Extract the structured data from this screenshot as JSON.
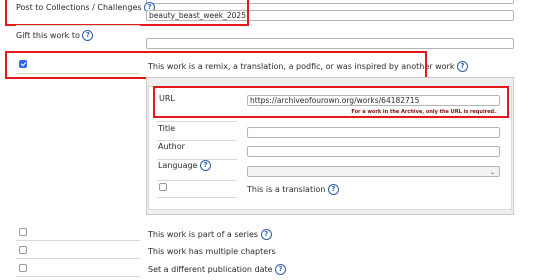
{
  "form": {
    "collections_label": "Post to Collections / Challenges",
    "collections_value": "beauty_beast_week_2025",
    "gift_label": "Gift this work to",
    "remix_label": "This work is a remix, a translation, a podfic, or was inspired by another work",
    "remix_checked": true,
    "parent_work": {
      "url_label": "URL",
      "url_value": "https://archiveofourown.org/works/64182715",
      "url_hint": "For a work in the Archive, only the URL is required.",
      "title_label": "Title",
      "author_label": "Author",
      "language_label": "Language",
      "translation_label": "This is a translation"
    },
    "series_label": "This work is part of a series",
    "chapters_label": "This work has multiple chapters",
    "pubdate_label": "Set a different publication date",
    "help_glyph": "?"
  },
  "colors": {
    "highlight": "#e3191b",
    "checkbox_accent": "#2a6de0",
    "help_icon": "#2b5fa8"
  },
  "icons": [
    "help-icon",
    "checkbox",
    "chevron-down-icon"
  ]
}
